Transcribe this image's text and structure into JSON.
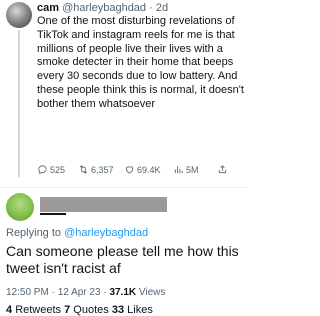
{
  "tweet1": {
    "name": "cam",
    "handle": "@harleybaghdad",
    "age": "2d",
    "separator": "·",
    "text": "One of the most disturbing revelations of TikTok and instagram reels for me is that millions of people live their lives with a smoke detecter in their home that beeps every 30 seconds due to low battery. And these people think this is normal, it doesn't bother them whatsoever",
    "actions": {
      "replies": "525",
      "retweets": "6,357",
      "likes": "69.4K",
      "views": "5M"
    },
    "icons": [
      "reply-icon",
      "retweet-icon",
      "like-icon",
      "views-icon",
      "share-icon"
    ]
  },
  "reply": {
    "replying_prefix": "Replying to",
    "replying_handle": "@harleybaghdad",
    "text": "Can someone please tell me how this tweet isn't racist af",
    "time": "12:50 PM",
    "date": "12 Apr 23",
    "views_count": "37.1K",
    "views_label": "Views",
    "dot": "·"
  },
  "stats": {
    "retweets_count": "4",
    "retweets_label": "Retweets",
    "quotes_count": "7",
    "quotes_label": "Quotes",
    "likes_count": "33",
    "likes_label": "Likes"
  },
  "colors": {
    "text": "#0f1419",
    "secondary": "#536471",
    "link": "#1d9bf0",
    "divider": "#eff3f4"
  }
}
